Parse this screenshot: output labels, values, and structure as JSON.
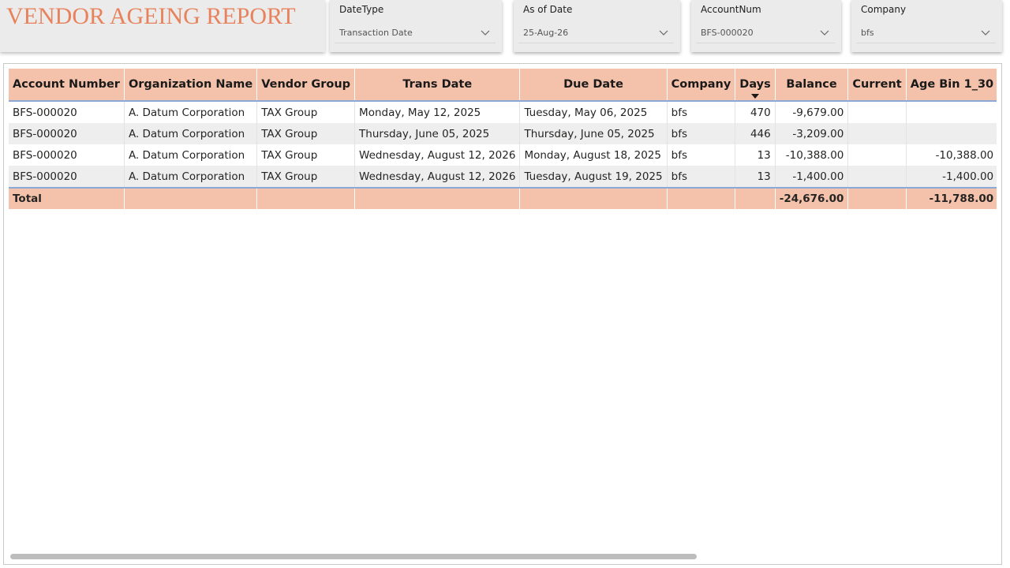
{
  "header": {
    "title": "VENDOR AGEING REPORT"
  },
  "slicers": [
    {
      "label": "DateType",
      "value": "Transaction Date"
    },
    {
      "label": "As of Date",
      "value": "25-Aug-26"
    },
    {
      "label": "AccountNum",
      "value": "BFS-000020"
    },
    {
      "label": "Company",
      "value": "bfs"
    }
  ],
  "table": {
    "columns": [
      "Account Number",
      "Organization Name",
      "Vendor Group",
      "Trans Date",
      "Due Date",
      "Company",
      "Days",
      "Balance",
      "Current",
      "Age Bin 1_30"
    ],
    "sorted_column": "Days",
    "sort_direction": "descending",
    "rows": [
      [
        "BFS-000020",
        "A. Datum Corporation",
        "TAX Group",
        "Monday, May 12, 2025",
        "Tuesday, May 06, 2025",
        "bfs",
        "470",
        "-9,679.00",
        "",
        ""
      ],
      [
        "BFS-000020",
        "A. Datum Corporation",
        "TAX Group",
        "Thursday, June 05, 2025",
        "Thursday, June 05, 2025",
        "bfs",
        "446",
        "-3,209.00",
        "",
        ""
      ],
      [
        "BFS-000020",
        "A. Datum Corporation",
        "TAX Group",
        "Wednesday, August 12, 2026",
        "Monday, August 18, 2025",
        "bfs",
        "13",
        "-10,388.00",
        "",
        "-10,388.00"
      ],
      [
        "BFS-000020",
        "A. Datum Corporation",
        "TAX Group",
        "Wednesday, August 12, 2026",
        "Tuesday, August 19, 2025",
        "bfs",
        "13",
        "-1,400.00",
        "",
        "-1,400.00"
      ]
    ],
    "total": [
      "Total",
      "",
      "",
      "",
      "",
      "",
      "",
      "-24,676.00",
      "",
      "-11,788.00"
    ]
  },
  "colors": {
    "title": "#e8825c",
    "header_fill": "#f4c2ab",
    "accent_line": "#8aa9d6"
  }
}
